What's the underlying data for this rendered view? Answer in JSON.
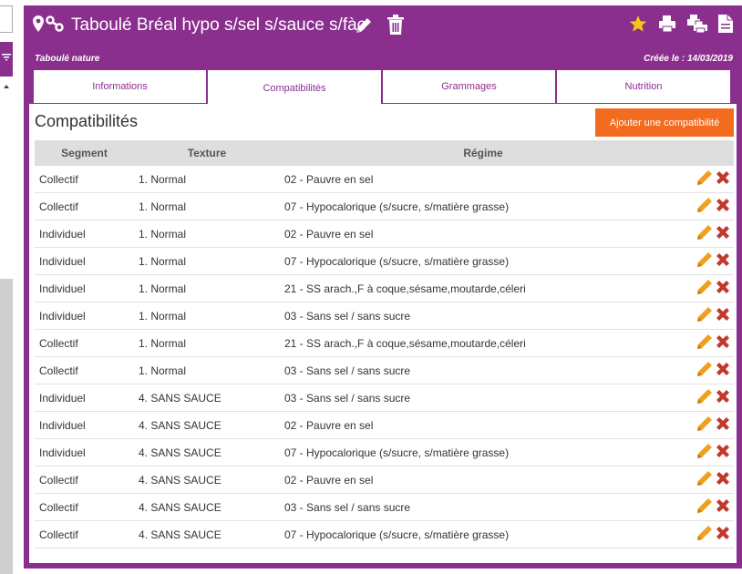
{
  "recipe": {
    "title": "Taboulé Bréal hypo s/sel s/sauce s/fàc",
    "subtitle": "Taboulé nature",
    "created": "Créée le : 14/03/2019"
  },
  "tabs": [
    {
      "label": "Informations",
      "active": false
    },
    {
      "label": "Compatibilités",
      "active": true
    },
    {
      "label": "Grammages",
      "active": false
    },
    {
      "label": "Nutrition",
      "active": false
    }
  ],
  "panel": {
    "title": "Compatibilités",
    "add_label": "Ajouter une compatibilité"
  },
  "table": {
    "headers": [
      "Segment",
      "Texture",
      "Régime"
    ],
    "rows": [
      [
        "Collectif",
        "1. Normal",
        "02 - Pauvre en sel"
      ],
      [
        "Collectif",
        "1. Normal",
        "07 - Hypocalorique (s/sucre, s/matière grasse)"
      ],
      [
        "Individuel",
        "1. Normal",
        "02 - Pauvre en sel"
      ],
      [
        "Individuel",
        "1. Normal",
        "07 - Hypocalorique (s/sucre, s/matière grasse)"
      ],
      [
        "Individuel",
        "1. Normal",
        "21 - SS arach.,F à coque,sésame,moutarde,céleri"
      ],
      [
        "Individuel",
        "1. Normal",
        "03 - Sans sel / sans sucre"
      ],
      [
        "Collectif",
        "1. Normal",
        "21 - SS arach.,F à coque,sésame,moutarde,céleri"
      ],
      [
        "Collectif",
        "1. Normal",
        "03 - Sans sel / sans sucre"
      ],
      [
        "Individuel",
        "4. SANS SAUCE",
        "03 - Sans sel / sans sucre"
      ],
      [
        "Individuel",
        "4. SANS SAUCE",
        "02 - Pauvre en sel"
      ],
      [
        "Individuel",
        "4. SANS SAUCE",
        "07 - Hypocalorique (s/sucre, s/matière grasse)"
      ],
      [
        "Collectif",
        "4. SANS SAUCE",
        "02 - Pauvre en sel"
      ],
      [
        "Collectif",
        "4. SANS SAUCE",
        "03 - Sans sel / sans sucre"
      ],
      [
        "Collectif",
        "4. SANS SAUCE",
        "07 - Hypocalorique (s/sucre, s/matière grasse)"
      ]
    ]
  },
  "colors": {
    "brand": "#8b2f8e",
    "accent_button": "#f26b1f",
    "edit_icon": "#f0a020",
    "delete_icon": "#c0392b",
    "star": "#f5c518"
  },
  "icons": {
    "title": [
      "map-marker-icon",
      "link-icon",
      "pencil-icon",
      "trash-icon"
    ],
    "toolbar": [
      "star-icon",
      "print-icon",
      "print-multiple-icon",
      "document-icon"
    ],
    "row_actions": [
      "edit-icon",
      "delete-icon"
    ]
  }
}
